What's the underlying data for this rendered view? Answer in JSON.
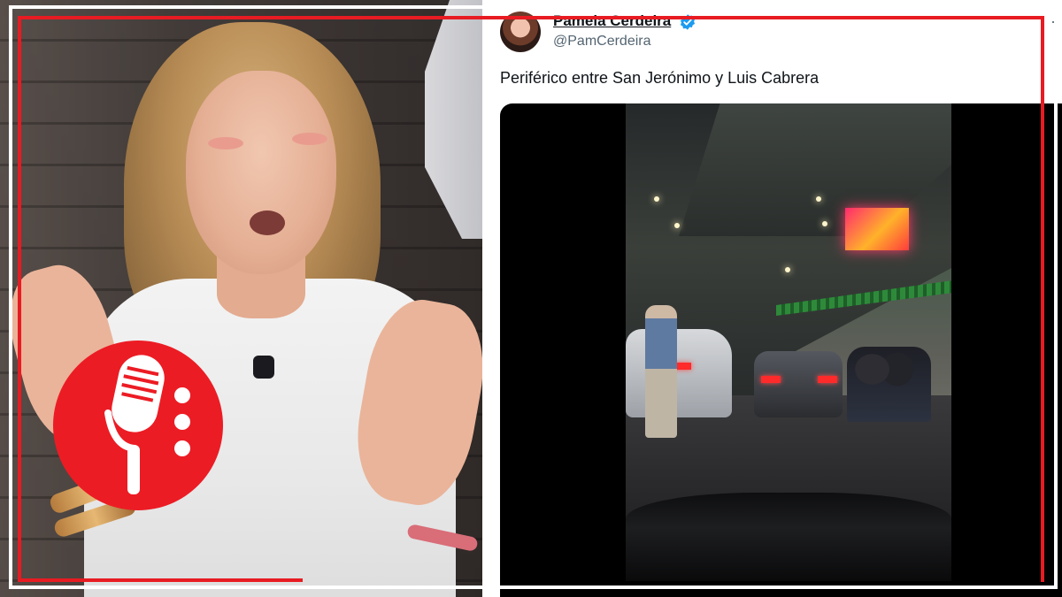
{
  "tweet": {
    "author_name": "Pamela Cerdeira",
    "author_handle": "@PamCerdeira",
    "verified": true,
    "text": "Periférico entre San Jerónimo y Luis Cabrera",
    "more_menu": "·"
  },
  "badge": {
    "icon": "microphone-icon",
    "color": "#ec1c24"
  },
  "frame": {
    "color": "#e81b22"
  },
  "colors": {
    "verified_badge": "#1d9bf0",
    "text_primary": "#0f1419",
    "text_secondary": "#536471"
  }
}
